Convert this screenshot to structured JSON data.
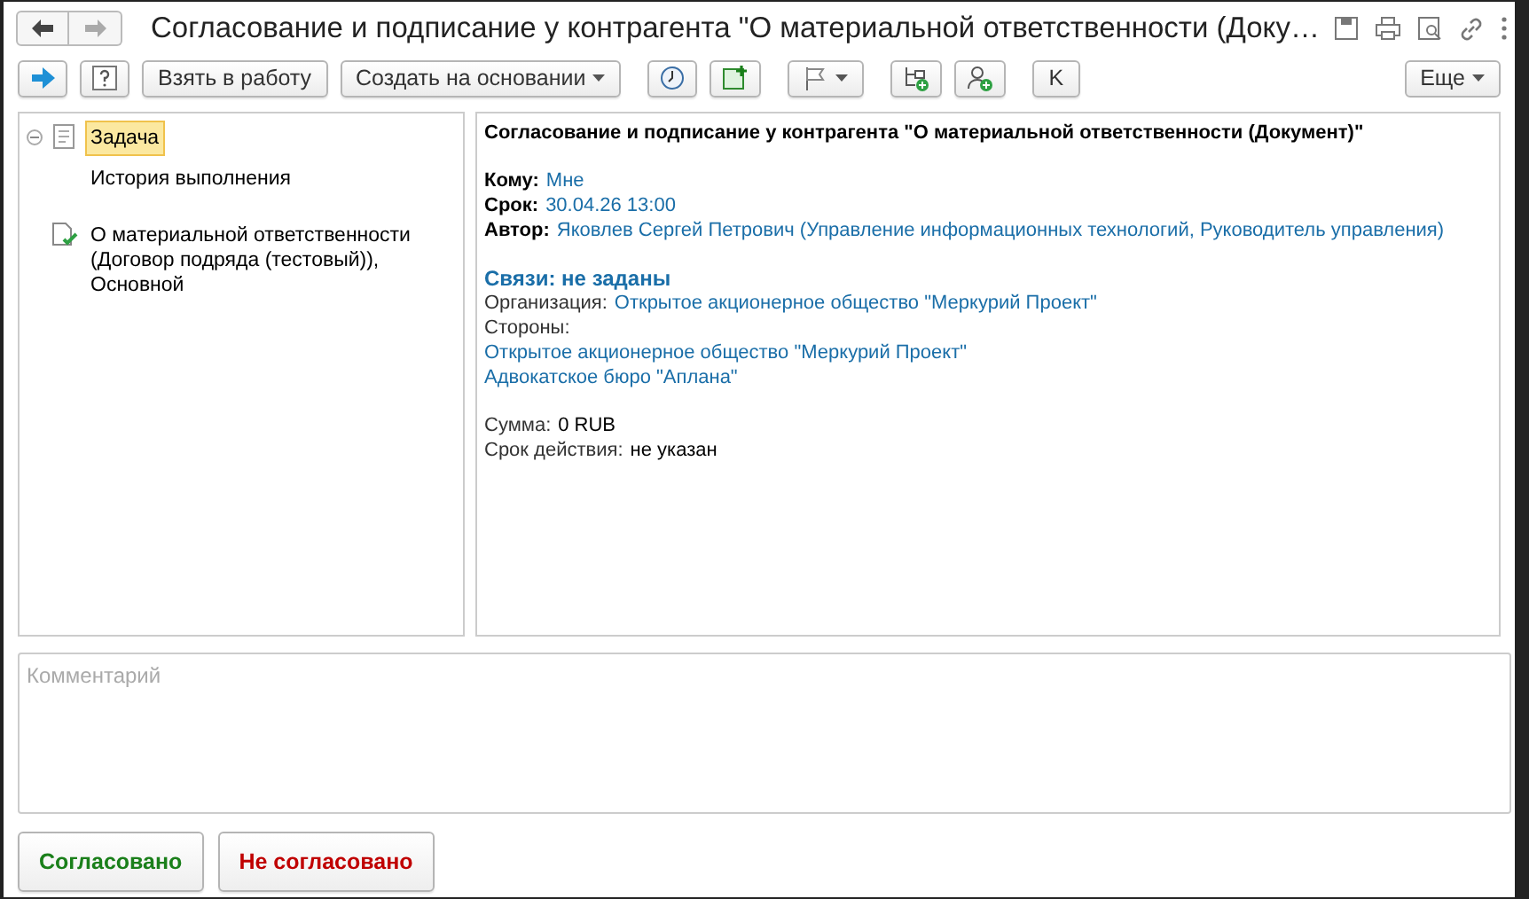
{
  "window": {
    "title": "Согласование и подписание у контрагента \"О материальной ответственности (Доку…"
  },
  "toolbar": [
    {
      "kind": "icon"
    },
    {
      "kind": "icon"
    },
    {
      "kind": "text",
      "label": "Взять в работу"
    },
    {
      "kind": "menu",
      "label": "Создать на основании"
    },
    {
      "kind": "icon"
    },
    {
      "kind": "icon"
    },
    {
      "kind": "icon-menu"
    },
    {
      "kind": "icon"
    },
    {
      "kind": "icon"
    },
    {
      "kind": "text",
      "label": "K"
    }
  ],
  "more_button": {
    "label": "Еще"
  },
  "tree": [
    {
      "kind": "task",
      "label": "Задача",
      "selected": true,
      "expanded": true,
      "children": [
        {
          "label": "История выполнения",
          "selected": false
        }
      ]
    },
    {
      "kind": "document",
      "label": "О материальной ответственности (Договор подряда (тестовый)), Основной",
      "selected": false
    }
  ],
  "details": {
    "heading": "Согласование и подписание у контрагента \"О материальной ответственности (Документ)\"",
    "blocks": [
      [
        {
          "kind": "bold-label",
          "label": "Кому:",
          "value": "Мне"
        },
        {
          "kind": "bold-label",
          "label": "Срок:",
          "value": "30.04.26 13:00"
        },
        {
          "kind": "bold-label",
          "label": "Автор:",
          "value": "Яковлев Сергей Петрович (Управление информационных технологий, Руководитель управления)"
        }
      ],
      [
        {
          "kind": "section",
          "label": "Связи: не заданы"
        },
        {
          "kind": "label-link",
          "label": "Организация:",
          "value": "Открытое акционерное общество \"Меркурий Проект\""
        },
        {
          "kind": "plain",
          "label": "Стороны:"
        },
        {
          "kind": "link",
          "value": "Открытое акционерное общество \"Меркурий Проект\""
        },
        {
          "kind": "link",
          "value": "Адвокатское бюро \"Аплана\""
        }
      ],
      [
        {
          "kind": "label-value",
          "label": "Сумма:",
          "value": "0 RUB"
        },
        {
          "kind": "label-value",
          "label": "Срок действия:",
          "value": "не указан"
        }
      ]
    ]
  },
  "comment": {
    "placeholder": "Комментарий"
  },
  "actions": [
    {
      "label": "Согласовано",
      "color": "#1a7f1a"
    },
    {
      "label": "Не согласовано",
      "color": "#c00000"
    }
  ]
}
